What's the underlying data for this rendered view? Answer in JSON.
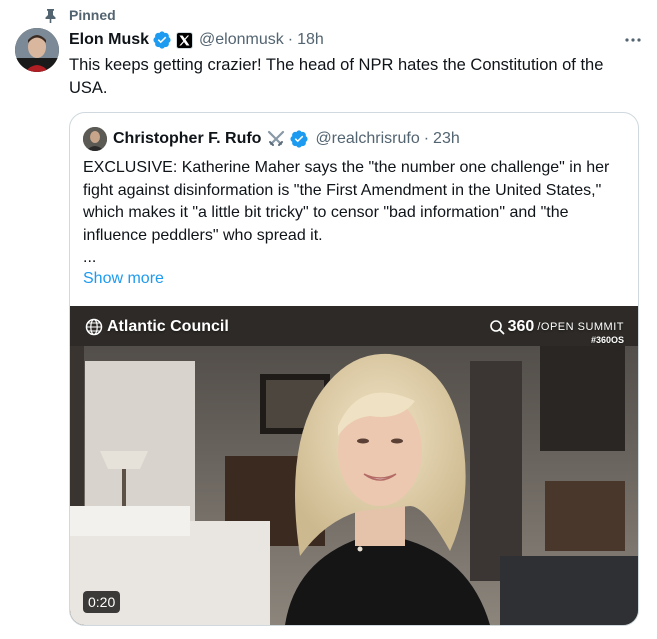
{
  "pinned": {
    "label": "Pinned"
  },
  "tweet": {
    "author_name": "Elon Musk",
    "handle": "@elonmusk",
    "separator": "·",
    "time": "18h",
    "more_label": "···",
    "text": "This keeps getting crazier! The head of NPR hates the Constitution of the USA."
  },
  "quote": {
    "author_name": "Christopher F. Rufo",
    "handle": "@realchrisrufo",
    "separator": "·",
    "time": "23h",
    "text": "EXCLUSIVE: Katherine Maher says the \"the number one challenge\" in her fight against disinformation is \"the First Amendment in the United States,\" which makes it \"a little bit tricky\" to censor \"bad information\" and \"the influence peddlers\" who spread it.",
    "ellipsis": "...",
    "show_more": "Show more"
  },
  "video": {
    "brand_left": "Atlantic Council",
    "brand_right_number": "360",
    "brand_right_sub": "/OPEN SUMMIT",
    "brand_right_tag": "#360OS",
    "duration": "0:20"
  },
  "colors": {
    "verified": "#1d9bf0",
    "link": "#1d9bf0",
    "muted": "#536471",
    "border": "#cfd9de"
  },
  "icons": {
    "pin": "pin-icon",
    "verified": "verified-badge-icon",
    "affiliation": "x-logo-icon",
    "more": "more-icon",
    "swords": "crossed-swords-icon",
    "globe": "globe-icon",
    "search_brand": "magnifier-icon"
  }
}
